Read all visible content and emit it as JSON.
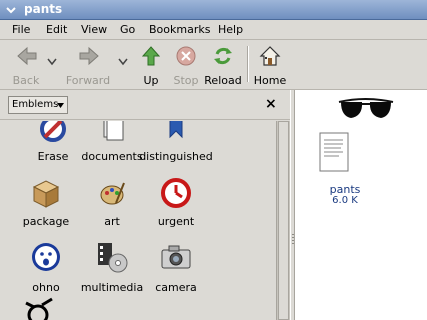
{
  "window": {
    "title": "pants"
  },
  "menubar": {
    "items": [
      "File",
      "Edit",
      "View",
      "Go",
      "Bookmarks",
      "Help"
    ]
  },
  "toolbar": {
    "back": "Back",
    "forward": "Forward",
    "up": "Up",
    "stop": "Stop",
    "reload": "Reload",
    "home": "Home"
  },
  "sidebar": {
    "selector": "Emblems",
    "emblems": [
      {
        "label": "Erase",
        "icon": "erase-icon"
      },
      {
        "label": "documents",
        "icon": "documents-icon"
      },
      {
        "label": "distinguished",
        "icon": "distinguished-icon"
      },
      {
        "label": "package",
        "icon": "package-icon"
      },
      {
        "label": "art",
        "icon": "art-icon"
      },
      {
        "label": "urgent",
        "icon": "urgent-icon"
      },
      {
        "label": "ohno",
        "icon": "ohno-icon"
      },
      {
        "label": "multimedia",
        "icon": "multimedia-icon"
      },
      {
        "label": "camera",
        "icon": "camera-icon"
      }
    ]
  },
  "files": [
    {
      "name": "pants",
      "size": "6.0 K",
      "emblem": "sunglasses-icon"
    }
  ]
}
